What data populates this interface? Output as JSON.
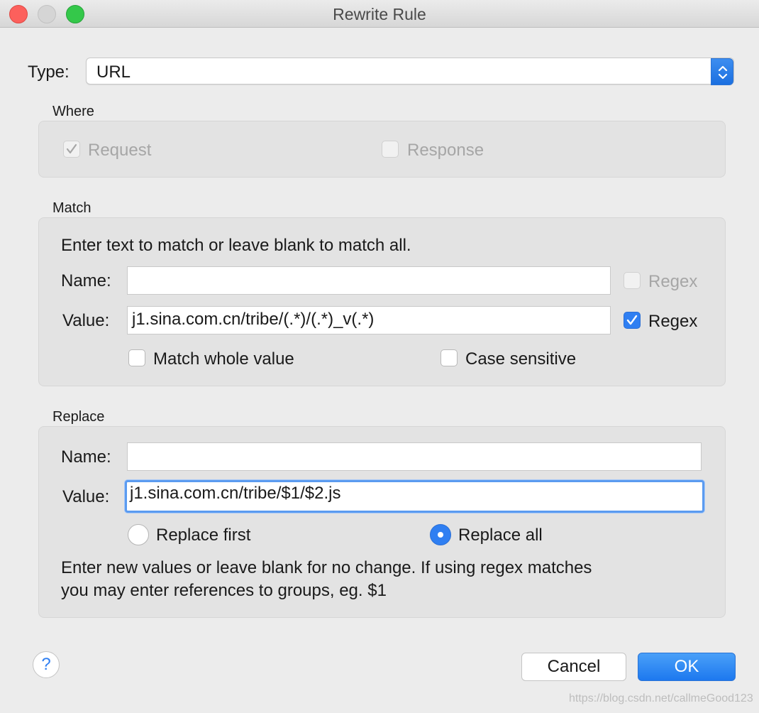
{
  "window": {
    "title": "Rewrite Rule"
  },
  "type_field": {
    "label": "Type:",
    "value": "URL"
  },
  "where": {
    "title": "Where",
    "request": {
      "label": "Request",
      "checked": true,
      "enabled": false
    },
    "response": {
      "label": "Response",
      "checked": false,
      "enabled": false
    }
  },
  "match": {
    "title": "Match",
    "instructions": "Enter text to match or leave blank to match all.",
    "name_label": "Name:",
    "name_value": "",
    "name_regex_label": "Regex",
    "value_label": "Value:",
    "value_value": "j1.sina.com.cn/tribe/(.*)/(.*)_v(.*)",
    "value_regex_label": "Regex",
    "match_whole_label": "Match whole value",
    "case_sensitive_label": "Case sensitive"
  },
  "replace": {
    "title": "Replace",
    "name_label": "Name:",
    "name_value": "",
    "value_label": "Value:",
    "value_value": "j1.sina.com.cn/tribe/$1/$2.js",
    "replace_first_label": "Replace first",
    "replace_all_label": "Replace all",
    "help_text_1": "Enter new values or leave blank for no change. If using regex matches",
    "help_text_2": "you may enter references to groups, eg. $1"
  },
  "buttons": {
    "help": "?",
    "cancel": "Cancel",
    "ok": "OK"
  },
  "watermark": "https://blog.csdn.net/callmeGood123",
  "colors": {
    "accent": "#2f7ff2",
    "close": "#fc605c",
    "maximize": "#34c84a"
  }
}
